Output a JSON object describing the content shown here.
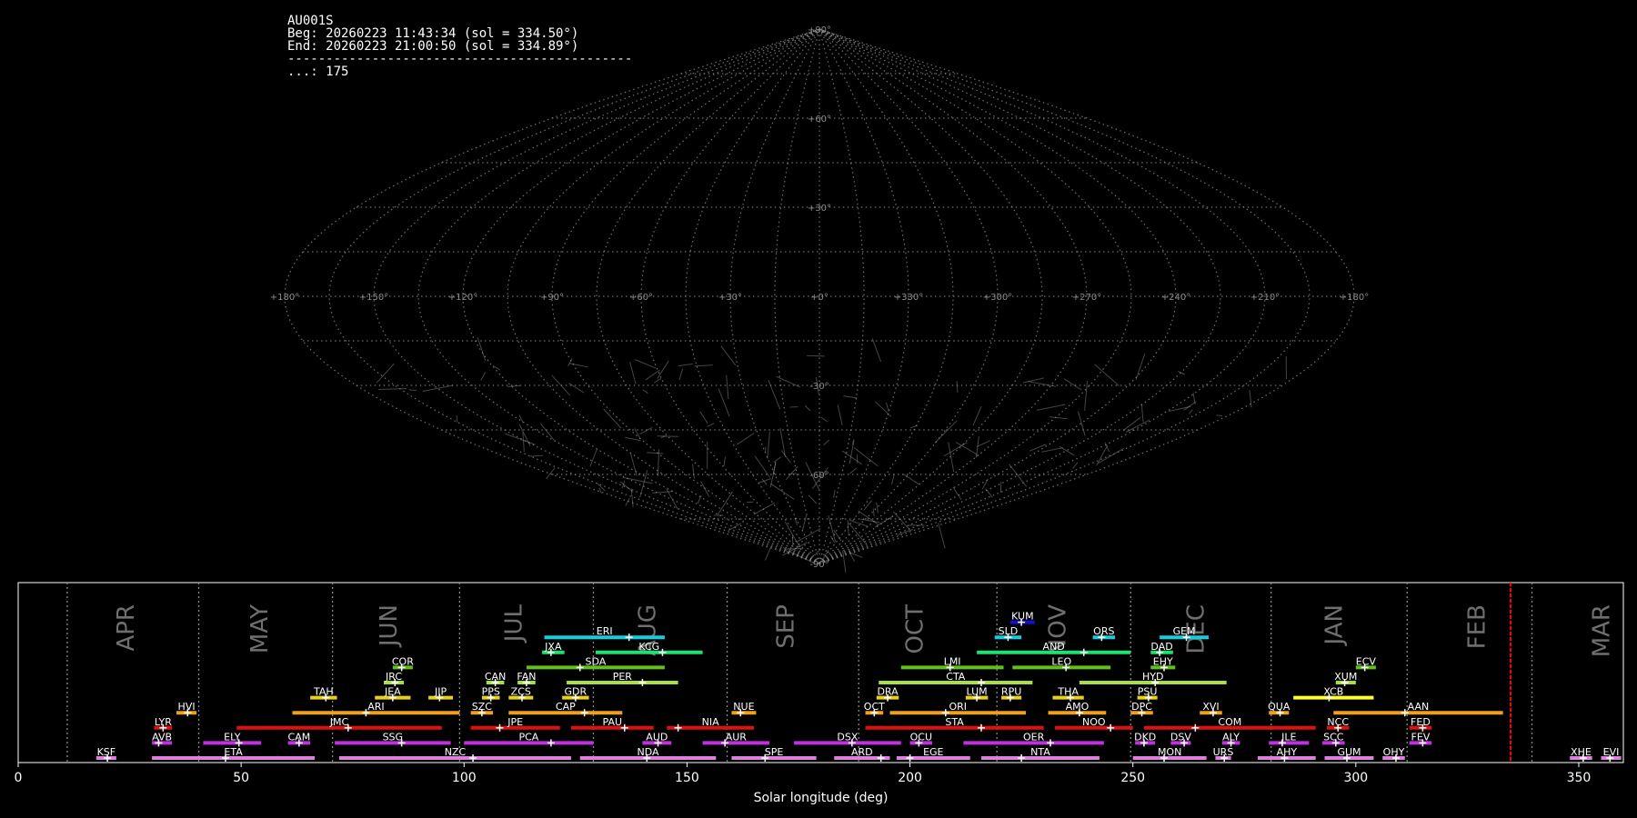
{
  "info": {
    "station": "AU001S",
    "begin": "Beg: 20260223 11:43:34 (sol = 334.50°)",
    "end": "End: 20260223 21:00:50 (sol = 334.89°)",
    "separator": "---------------------------------------------",
    "count": "...: 175"
  },
  "sky_map": {
    "projection": "sinusoidal",
    "longitude_labels": [
      "+180°",
      "+150°",
      "+120°",
      "+90°",
      "+60°",
      "+30°",
      "+0°",
      "+330°",
      "+300°",
      "+270°",
      "+240°",
      "+210°",
      "+180°"
    ],
    "latitude_labels": [
      "+90°",
      "+60°",
      "+30°",
      "-30°",
      "-60°",
      "-90°"
    ],
    "grid_color": "#8a8a8a",
    "meteor_count": 175
  },
  "chart_data": {
    "type": "timeline",
    "xlabel": "Solar longitude (deg)",
    "xlim": [
      0,
      360
    ],
    "xticks": [
      0,
      50,
      100,
      150,
      200,
      250,
      300,
      350
    ],
    "month_boundaries": [
      11,
      40.5,
      70.5,
      99,
      129,
      159,
      188.5,
      219.5,
      249.5,
      281,
      311.5,
      339.5
    ],
    "months": [
      {
        "label": "APR",
        "pos": 24
      },
      {
        "label": "MAY",
        "pos": 54
      },
      {
        "label": "JUN",
        "pos": 83
      },
      {
        "label": "JUL",
        "pos": 111
      },
      {
        "label": "AUG",
        "pos": 141
      },
      {
        "label": "SEP",
        "pos": 172
      },
      {
        "label": "OCT",
        "pos": 201
      },
      {
        "label": "NOV",
        "pos": 233
      },
      {
        "label": "DEC",
        "pos": 264
      },
      {
        "label": "JAN",
        "pos": 295
      },
      {
        "label": "FEB",
        "pos": 327
      },
      {
        "label": "MAR",
        "pos": 355
      }
    ],
    "current_sol": 334.7,
    "current_color": "#ff0000",
    "showers": [
      {
        "code": "KSF",
        "start": 17.5,
        "end": 22,
        "peak": 20,
        "row": 0,
        "color": "#e07ee0"
      },
      {
        "code": "ETA",
        "start": 30,
        "end": 66.5,
        "peak": 46.5,
        "row": 0,
        "color": "#e07ee0"
      },
      {
        "code": "NZC",
        "start": 72,
        "end": 124,
        "peak": 102,
        "row": 0,
        "color": "#e07ee0"
      },
      {
        "code": "NDA",
        "start": 126,
        "end": 156.5,
        "peak": 141,
        "row": 0,
        "color": "#e07ee0"
      },
      {
        "code": "SPE",
        "start": 160,
        "end": 179,
        "peak": 167.5,
        "row": 0,
        "color": "#e07ee0"
      },
      {
        "code": "ARD",
        "start": 183,
        "end": 195.5,
        "peak": 193.5,
        "row": 0,
        "color": "#e07ee0"
      },
      {
        "code": "EGE",
        "start": 197,
        "end": 213.5,
        "peak": 200,
        "row": 0,
        "color": "#e07ee0"
      },
      {
        "code": "NTA",
        "start": 216,
        "end": 242.5,
        "peak": 225,
        "row": 0,
        "color": "#e07ee0"
      },
      {
        "code": "MON",
        "start": 250,
        "end": 266.5,
        "peak": 257,
        "row": 0,
        "color": "#e07ee0"
      },
      {
        "code": "URS",
        "start": 268.5,
        "end": 272,
        "peak": 270.5,
        "row": 0,
        "color": "#e07ee0"
      },
      {
        "code": "AHY",
        "start": 278,
        "end": 291,
        "peak": 284,
        "row": 0,
        "color": "#e07ee0"
      },
      {
        "code": "GUM",
        "start": 293,
        "end": 304,
        "peak": 298,
        "row": 0,
        "color": "#e07ee0"
      },
      {
        "code": "OHY",
        "start": 306,
        "end": 311,
        "peak": 309,
        "row": 0,
        "color": "#e07ee0"
      },
      {
        "code": "XHE",
        "start": 348,
        "end": 353,
        "peak": 351,
        "row": 0,
        "color": "#e07ee0"
      },
      {
        "code": "EVI",
        "start": 355,
        "end": 359.5,
        "peak": 357,
        "row": 0,
        "color": "#e07ee0"
      },
      {
        "code": "AVB",
        "start": 30,
        "end": 34.5,
        "peak": 31.5,
        "row": 1,
        "color": "#c030e0"
      },
      {
        "code": "ELY",
        "start": 41.5,
        "end": 54.5,
        "peak": 49.5,
        "row": 1,
        "color": "#c030e0"
      },
      {
        "code": "CAM",
        "start": 60.5,
        "end": 65.5,
        "peak": 63,
        "row": 1,
        "color": "#c030e0"
      },
      {
        "code": "SSG",
        "start": 71,
        "end": 97,
        "peak": 86,
        "row": 1,
        "color": "#c030e0"
      },
      {
        "code": "PCA",
        "start": 100,
        "end": 129,
        "peak": 119.5,
        "row": 1,
        "color": "#c030e0"
      },
      {
        "code": "AUD",
        "start": 140,
        "end": 146.5,
        "peak": 143.5,
        "row": 1,
        "color": "#c030e0"
      },
      {
        "code": "AUR",
        "start": 153.5,
        "end": 168.5,
        "peak": 158.5,
        "row": 1,
        "color": "#c030e0"
      },
      {
        "code": "DSX",
        "start": 174,
        "end": 198,
        "peak": 187,
        "row": 1,
        "color": "#c030e0"
      },
      {
        "code": "OCU",
        "start": 200,
        "end": 205,
        "peak": 202,
        "row": 1,
        "color": "#c030e0"
      },
      {
        "code": "OER",
        "start": 212,
        "end": 243.5,
        "peak": 231.5,
        "row": 1,
        "color": "#c030e0"
      },
      {
        "code": "DKD",
        "start": 250.5,
        "end": 255,
        "peak": 252.5,
        "row": 1,
        "color": "#c030e0"
      },
      {
        "code": "DSV",
        "start": 258.5,
        "end": 263,
        "peak": 261.5,
        "row": 1,
        "color": "#c030e0"
      },
      {
        "code": "ALY",
        "start": 270,
        "end": 274,
        "peak": 272,
        "row": 1,
        "color": "#c030e0"
      },
      {
        "code": "JLE",
        "start": 280.5,
        "end": 289.5,
        "peak": 283.5,
        "row": 1,
        "color": "#c030e0"
      },
      {
        "code": "SCC",
        "start": 292.5,
        "end": 297.5,
        "peak": 295.5,
        "row": 1,
        "color": "#c030e0"
      },
      {
        "code": "FEV",
        "start": 312,
        "end": 317,
        "peak": 315,
        "row": 1,
        "color": "#c030e0"
      },
      {
        "code": "LYR",
        "start": 30.5,
        "end": 34.5,
        "peak": 32.5,
        "row": 2,
        "color": "#e01010"
      },
      {
        "code": "JMC",
        "start": 49,
        "end": 95,
        "peak": 74,
        "row": 2,
        "color": "#e01010"
      },
      {
        "code": "JPE",
        "start": 101.5,
        "end": 121.5,
        "peak": 108,
        "row": 2,
        "color": "#e01010"
      },
      {
        "code": "PAU",
        "start": 124,
        "end": 142.5,
        "peak": 136,
        "row": 2,
        "color": "#e01010"
      },
      {
        "code": "NIA",
        "start": 145.5,
        "end": 165,
        "peak": 148,
        "row": 2,
        "color": "#e01010"
      },
      {
        "code": "STA",
        "start": 190,
        "end": 230,
        "peak": 216,
        "row": 2,
        "color": "#e01010"
      },
      {
        "code": "NOO",
        "start": 232.5,
        "end": 250,
        "peak": 245,
        "row": 2,
        "color": "#e01010"
      },
      {
        "code": "COM",
        "start": 252.5,
        "end": 291,
        "peak": 264,
        "row": 2,
        "color": "#e01010"
      },
      {
        "code": "NCC",
        "start": 293.5,
        "end": 298.5,
        "peak": 296,
        "row": 2,
        "color": "#e01010"
      },
      {
        "code": "FED",
        "start": 312,
        "end": 317,
        "peak": 315,
        "row": 2,
        "color": "#e01010"
      },
      {
        "code": "HVI",
        "start": 35.5,
        "end": 40,
        "peak": 38,
        "row": 3,
        "color": "#f0a020"
      },
      {
        "code": "ARI",
        "start": 61.5,
        "end": 99,
        "peak": 78,
        "row": 3,
        "color": "#f0a020"
      },
      {
        "code": "SZC",
        "start": 101.5,
        "end": 106.5,
        "peak": 104,
        "row": 3,
        "color": "#f0a020"
      },
      {
        "code": "CAP",
        "start": 110,
        "end": 135.5,
        "peak": 127,
        "row": 3,
        "color": "#f0a020"
      },
      {
        "code": "NUE",
        "start": 160,
        "end": 165.5,
        "peak": 162,
        "row": 3,
        "color": "#f0a020"
      },
      {
        "code": "OCT",
        "start": 190,
        "end": 194,
        "peak": 192,
        "row": 3,
        "color": "#f0a020"
      },
      {
        "code": "ORI",
        "start": 195.5,
        "end": 226,
        "peak": 208,
        "row": 3,
        "color": "#f0a020"
      },
      {
        "code": "AMO",
        "start": 231,
        "end": 244,
        "peak": 238,
        "row": 3,
        "color": "#f0a020"
      },
      {
        "code": "DPC",
        "start": 249.5,
        "end": 254.5,
        "peak": 252,
        "row": 3,
        "color": "#f0a020"
      },
      {
        "code": "XVI",
        "start": 265,
        "end": 270,
        "peak": 268,
        "row": 3,
        "color": "#f0a020"
      },
      {
        "code": "QUA",
        "start": 280.5,
        "end": 285,
        "peak": 283,
        "row": 3,
        "color": "#f0a020"
      },
      {
        "code": "AAN",
        "start": 295,
        "end": 333,
        "peak": 311,
        "row": 3,
        "color": "#f0a020"
      },
      {
        "code": "TAH",
        "start": 65.5,
        "end": 71.5,
        "peak": 69,
        "row": 4,
        "color": "#e8d020"
      },
      {
        "code": "JEA",
        "start": 80,
        "end": 88,
        "peak": 84,
        "row": 4,
        "color": "#e8d020"
      },
      {
        "code": "JIP",
        "start": 92,
        "end": 97.5,
        "peak": 94.5,
        "row": 4,
        "color": "#e8d020"
      },
      {
        "code": "PPS",
        "start": 104,
        "end": 108,
        "peak": 106,
        "row": 4,
        "color": "#e8d020"
      },
      {
        "code": "ZCS",
        "start": 110,
        "end": 115.5,
        "peak": 113,
        "row": 4,
        "color": "#e8d020"
      },
      {
        "code": "GDR",
        "start": 122,
        "end": 128,
        "peak": 125,
        "row": 4,
        "color": "#e8d020"
      },
      {
        "code": "DRA",
        "start": 192.5,
        "end": 197.5,
        "peak": 195,
        "row": 4,
        "color": "#e8d020"
      },
      {
        "code": "LUM",
        "start": 212.5,
        "end": 217.5,
        "peak": 215,
        "row": 4,
        "color": "#e8d020"
      },
      {
        "code": "RPU",
        "start": 220.5,
        "end": 225,
        "peak": 222.5,
        "row": 4,
        "color": "#e8d020"
      },
      {
        "code": "THA",
        "start": 232,
        "end": 239,
        "peak": 236,
        "row": 4,
        "color": "#e8d020"
      },
      {
        "code": "PSU",
        "start": 251,
        "end": 255.5,
        "peak": 253.5,
        "row": 4,
        "color": "#e8d020"
      },
      {
        "code": "XCB",
        "start": 286,
        "end": 304,
        "peak": 294,
        "row": 4,
        "color": "#ffff30"
      },
      {
        "code": "JRC",
        "start": 82,
        "end": 86.5,
        "peak": 84.5,
        "row": 5,
        "color": "#a8e040"
      },
      {
        "code": "CAN",
        "start": 105,
        "end": 109,
        "peak": 107,
        "row": 5,
        "color": "#a8e040"
      },
      {
        "code": "FAN",
        "start": 112,
        "end": 116,
        "peak": 114,
        "row": 5,
        "color": "#a8e040"
      },
      {
        "code": "PER",
        "start": 123,
        "end": 148,
        "peak": 140,
        "row": 5,
        "color": "#a8e040"
      },
      {
        "code": "CTA",
        "start": 193,
        "end": 227.5,
        "peak": 216,
        "row": 5,
        "color": "#a8e040"
      },
      {
        "code": "HYD",
        "start": 238,
        "end": 271,
        "peak": 255,
        "row": 5,
        "color": "#a8e040"
      },
      {
        "code": "XUM",
        "start": 295.5,
        "end": 300,
        "peak": 297.5,
        "row": 5,
        "color": "#a8e040"
      },
      {
        "code": "COR",
        "start": 84,
        "end": 88.5,
        "peak": 86,
        "row": 6,
        "color": "#60c020"
      },
      {
        "code": "SDA",
        "start": 114,
        "end": 145,
        "peak": 126,
        "row": 6,
        "color": "#60c020"
      },
      {
        "code": "LMI",
        "start": 198,
        "end": 221,
        "peak": 209,
        "row": 6,
        "color": "#60c020"
      },
      {
        "code": "LEO",
        "start": 223,
        "end": 245,
        "peak": 235,
        "row": 6,
        "color": "#60c020"
      },
      {
        "code": "EHY",
        "start": 254,
        "end": 259.5,
        "peak": 257,
        "row": 6,
        "color": "#60c020"
      },
      {
        "code": "ECV",
        "start": 300,
        "end": 304.5,
        "peak": 302,
        "row": 6,
        "color": "#60c020"
      },
      {
        "code": "JXA",
        "start": 117.5,
        "end": 122.5,
        "peak": 119.5,
        "row": 7,
        "color": "#20e070"
      },
      {
        "code": "KCG",
        "start": 129.5,
        "end": 153.5,
        "peak": 144.5,
        "row": 7,
        "color": "#20e070"
      },
      {
        "code": "AND",
        "start": 215,
        "end": 249.5,
        "peak": 239,
        "row": 7,
        "color": "#20e070"
      },
      {
        "code": "DAD",
        "start": 254,
        "end": 259,
        "peak": 256,
        "row": 7,
        "color": "#20e070"
      },
      {
        "code": "ERI",
        "start": 118,
        "end": 145,
        "peak": 137,
        "row": 8,
        "color": "#10d0e0"
      },
      {
        "code": "SLD",
        "start": 219,
        "end": 225,
        "peak": 222,
        "row": 8,
        "color": "#10d0e0"
      },
      {
        "code": "ORS",
        "start": 241,
        "end": 246,
        "peak": 243,
        "row": 8,
        "color": "#10d0e0"
      },
      {
        "code": "GEM",
        "start": 256,
        "end": 267,
        "peak": 262,
        "row": 8,
        "color": "#10d0e0"
      },
      {
        "code": "KUM",
        "start": 222.5,
        "end": 228,
        "peak": 225,
        "row": 9,
        "color": "#1010d0"
      }
    ]
  }
}
